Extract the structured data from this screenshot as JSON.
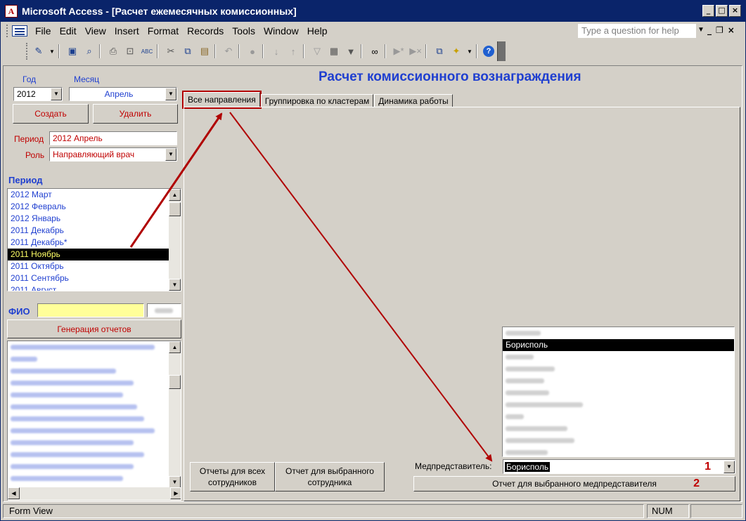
{
  "window": {
    "title": "Microsoft Access - [Расчет ежемесячных комиссионных]",
    "app_icon_letter": "A",
    "controls": [
      "_",
      "□",
      "×"
    ]
  },
  "menubar": {
    "items": [
      "File",
      "Edit",
      "View",
      "Insert",
      "Format",
      "Records",
      "Tools",
      "Window",
      "Help"
    ],
    "question_placeholder": "Type a question for help"
  },
  "toolbar": {
    "icons": [
      "view-icon",
      "save-icon",
      "search-file-icon",
      "print-icon",
      "print-preview-icon",
      "spelling-icon",
      "cut-icon",
      "copy-icon",
      "paste-icon",
      "undo-icon",
      "hyperlink-icon",
      "sort-ascending-icon",
      "sort-descending-icon",
      "filter-by-selection-icon",
      "filter-by-form-icon",
      "apply-filter-icon",
      "find-icon",
      "new-record-icon",
      "delete-record-icon",
      "database-window-icon",
      "new-object-icon",
      "help-icon"
    ]
  },
  "left": {
    "year_label": "Год",
    "month_label": "Месяц",
    "year_value": "2012",
    "month_value": "Апрель",
    "create_button": "Создать",
    "delete_button": "Удалить",
    "period_label": "Период",
    "period_value": "2012 Апрель",
    "role_label": "Роль",
    "role_value": "Направляющий врач",
    "period_list_heading": "Период",
    "period_list": [
      "2012 Март",
      "2012 Февраль",
      "2012 Январь",
      "2011 Декабрь",
      "2011 Декабрь*",
      "2011 Ноябрь",
      "2011 Октябрь",
      "2011 Сентябрь",
      "2011 Август"
    ],
    "selected_period_index": 5,
    "fio_label": "ФИО",
    "fio_value": "",
    "generate_button": "Генерация отчетов",
    "employees_blurred_count": 12
  },
  "main": {
    "heading": "Расчет комиссионного вознаграждения",
    "tabs": [
      "Все направления",
      "Группировка по кластерам",
      "Динамика работы"
    ],
    "active_tab": 0,
    "rep_list_selected": "Борисполь",
    "rep_list_blurred_count": 10,
    "rep_label": "Медпредставитель:",
    "rep_value": "Борисполь",
    "marker_1": "1",
    "marker_2": "2",
    "btn_all_reports": "Отчеты для всех сотрудников",
    "btn_selected_employee": "Отчет для выбранного сотрудника",
    "btn_selected_rep": "Отчет для выбранного медпредставителя"
  },
  "status": {
    "mode": "Form View",
    "num": "NUM"
  },
  "colors": {
    "accent_blue": "#1f3fd0",
    "label_red": "#c00000",
    "arrow_red": "#b00000",
    "selection_bg": "#000000",
    "selection_fg": "#ffff66",
    "fio_bg": "#ffff99"
  }
}
